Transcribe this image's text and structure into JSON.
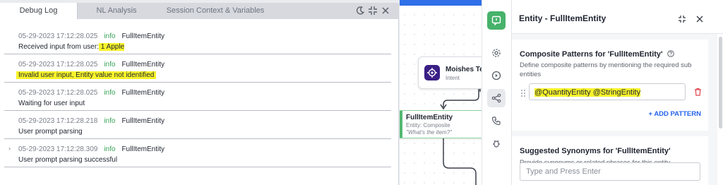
{
  "debug": {
    "tabs": [
      "Debug Log",
      "NL Analysis",
      "Session Context & Variables"
    ],
    "entries": [
      {
        "time": "05-29-2023 17:12:28.025",
        "level": "info",
        "entity": "FullItemEntity",
        "msg_prefix": "Received input from user:",
        "msg_highlight": " 1 Apple ",
        "msg_suffix": ""
      },
      {
        "time": "05-29-2023 17:12:28.025",
        "level": "info",
        "entity": "FullItemEntity",
        "msg_prefix": "",
        "msg_highlight": "Invalid user input, Entity value not identified",
        "msg_suffix": ""
      },
      {
        "time": "05-29-2023 17:12:28.025",
        "level": "info",
        "entity": "FullItemEntity",
        "msg_prefix": "Waiting for user input",
        "msg_highlight": "",
        "msg_suffix": ""
      },
      {
        "time": "05-29-2023 17:12:28.218",
        "level": "info",
        "entity": "FullItemEntity",
        "msg_prefix": "User prompt parsing",
        "msg_highlight": "",
        "msg_suffix": ""
      },
      {
        "time": "05-29-2023 17:12:28.309",
        "level": "info",
        "entity": "FullItemEntity",
        "msg_prefix": "User prompt parsing successful",
        "msg_highlight": "",
        "msg_suffix": ""
      }
    ]
  },
  "canvas": {
    "intent_node": {
      "title": "Moishes Test",
      "subtitle": "Intent"
    },
    "entity_node": {
      "title": "FullItemEntity",
      "subtitle": "Entity: Composite",
      "prompt": "\"What's the item?\""
    }
  },
  "panel": {
    "title": "Entity - FullItemEntity",
    "patterns": {
      "title": "Composite Patterns for 'FullItemEntity'",
      "description": "Define composite patterns by mentioning the required sub entities",
      "value": "@QuantityEntity @StringEntity",
      "add_label": "+ ADD PATTERN"
    },
    "synonyms": {
      "title": "Suggested Synonyms for 'FullItemEntity'",
      "description": "Provide synonyms or related phrases for this entity.",
      "placeholder": "Type and Press Enter"
    }
  },
  "colors": {
    "highlight": "#f7f32a",
    "info": "#3aa35a",
    "accent_green": "#47b26b",
    "link_blue": "#2563eb",
    "intent_purple": "#3a1f86"
  }
}
